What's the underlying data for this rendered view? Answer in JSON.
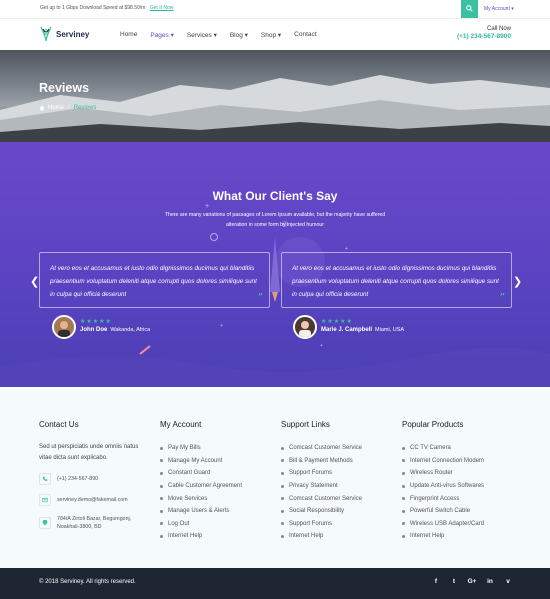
{
  "topbar": {
    "promo_text": "Get up to 1 Gbps Download Speed at $98.50/m",
    "promo_link": "Get It Now",
    "account": "My Account ▾"
  },
  "header": {
    "brand": "Serviney",
    "nav": [
      "Home",
      "Pages ▾",
      "Services ▾",
      "Blog ▾",
      "Shop ▾",
      "Contact"
    ],
    "call_label": "Call Now",
    "call_number": "(+1) 234-567-8900"
  },
  "hero": {
    "title": "Reviews",
    "crumb_home": "Home",
    "crumb_sep": "/",
    "crumb_current": "Reviews"
  },
  "testimonials": {
    "title": "What Our Client's Say",
    "subtitle": "There are many variations of passages of Lorem Ipsum available, but the majority have suffered alteration in some form by injected humour",
    "cards": [
      {
        "quote": "At vero eos et accusamus et iusto odio dignissimos ducimus qui blanditiis praesentium voluptatum deleniti atque corrupti quos dolores similique sunt in culpa qui officia deserunt",
        "stars": "★★★★★",
        "name": "John Doe",
        "location": "Wakanda, Africa"
      },
      {
        "quote": "At vero eos et accusamus et iusto odio dignissimos ducimus qui blanditiis praesentium voluptatum deleniti atque corrupti quos dolores similique sunt in culpa qui officia deserunt",
        "stars": "★★★★★",
        "name": "Marie J. Campbell",
        "location": "Miami, USA"
      }
    ]
  },
  "footer": {
    "contact": {
      "title": "Contact Us",
      "text": "Sed ut perspiciatis unde omniis natus vitae dicta sunt explicabo.",
      "phone": "(+1) 234-567-890",
      "email": "serviney.demo@fakemail.com",
      "address": "784/A Zirtoli Bazar, Begumgonj, Noakhali-3800, BD"
    },
    "account": {
      "title": "My Account",
      "items": [
        "Pay My Bills",
        "Manage My Account",
        "Constant Guard",
        "Cable Customer Agreement",
        "Move Services",
        "Manage Users & Alerts",
        "Log Out",
        "Internet Help"
      ]
    },
    "support": {
      "title": "Support Links",
      "items": [
        "Comcast Customer Service",
        "Bill & Payment Methods",
        "Support Forums",
        "Privacy Statement",
        "Comcast Customer Service",
        "Social Responsibility",
        "Support Forums",
        "Internet Help"
      ]
    },
    "products": {
      "title": "Popular Products",
      "items": [
        "CC TV Camera",
        "Internet Connection Modem",
        "Wireless Router",
        "Update Anti-virus Softwares",
        "Fingerprint Access",
        "Powerful Switch Cable",
        "Wireless USB Adapter/Card",
        "Internet Help"
      ]
    },
    "copyright": "© 2018 Serviney. All rights reserved.",
    "social": [
      "f",
      "t",
      "G+",
      "in",
      "v"
    ]
  },
  "colors": {
    "accent": "#3cc1a0",
    "purple": "#6a49c8",
    "footer_dark": "#1d2632"
  }
}
